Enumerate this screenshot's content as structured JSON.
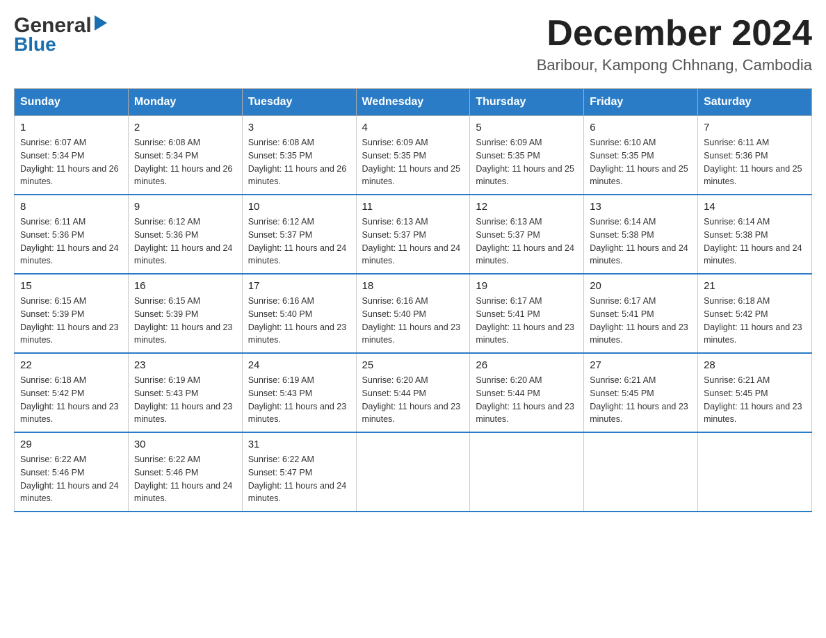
{
  "logo": {
    "general": "General",
    "blue": "Blue"
  },
  "header": {
    "month_year": "December 2024",
    "location": "Baribour, Kampong Chhnang, Cambodia"
  },
  "days_of_week": [
    "Sunday",
    "Monday",
    "Tuesday",
    "Wednesday",
    "Thursday",
    "Friday",
    "Saturday"
  ],
  "weeks": [
    [
      {
        "day": "1",
        "sunrise": "6:07 AM",
        "sunset": "5:34 PM",
        "daylight": "11 hours and 26 minutes."
      },
      {
        "day": "2",
        "sunrise": "6:08 AM",
        "sunset": "5:34 PM",
        "daylight": "11 hours and 26 minutes."
      },
      {
        "day": "3",
        "sunrise": "6:08 AM",
        "sunset": "5:35 PM",
        "daylight": "11 hours and 26 minutes."
      },
      {
        "day": "4",
        "sunrise": "6:09 AM",
        "sunset": "5:35 PM",
        "daylight": "11 hours and 25 minutes."
      },
      {
        "day": "5",
        "sunrise": "6:09 AM",
        "sunset": "5:35 PM",
        "daylight": "11 hours and 25 minutes."
      },
      {
        "day": "6",
        "sunrise": "6:10 AM",
        "sunset": "5:35 PM",
        "daylight": "11 hours and 25 minutes."
      },
      {
        "day": "7",
        "sunrise": "6:11 AM",
        "sunset": "5:36 PM",
        "daylight": "11 hours and 25 minutes."
      }
    ],
    [
      {
        "day": "8",
        "sunrise": "6:11 AM",
        "sunset": "5:36 PM",
        "daylight": "11 hours and 24 minutes."
      },
      {
        "day": "9",
        "sunrise": "6:12 AM",
        "sunset": "5:36 PM",
        "daylight": "11 hours and 24 minutes."
      },
      {
        "day": "10",
        "sunrise": "6:12 AM",
        "sunset": "5:37 PM",
        "daylight": "11 hours and 24 minutes."
      },
      {
        "day": "11",
        "sunrise": "6:13 AM",
        "sunset": "5:37 PM",
        "daylight": "11 hours and 24 minutes."
      },
      {
        "day": "12",
        "sunrise": "6:13 AM",
        "sunset": "5:37 PM",
        "daylight": "11 hours and 24 minutes."
      },
      {
        "day": "13",
        "sunrise": "6:14 AM",
        "sunset": "5:38 PM",
        "daylight": "11 hours and 24 minutes."
      },
      {
        "day": "14",
        "sunrise": "6:14 AM",
        "sunset": "5:38 PM",
        "daylight": "11 hours and 24 minutes."
      }
    ],
    [
      {
        "day": "15",
        "sunrise": "6:15 AM",
        "sunset": "5:39 PM",
        "daylight": "11 hours and 23 minutes."
      },
      {
        "day": "16",
        "sunrise": "6:15 AM",
        "sunset": "5:39 PM",
        "daylight": "11 hours and 23 minutes."
      },
      {
        "day": "17",
        "sunrise": "6:16 AM",
        "sunset": "5:40 PM",
        "daylight": "11 hours and 23 minutes."
      },
      {
        "day": "18",
        "sunrise": "6:16 AM",
        "sunset": "5:40 PM",
        "daylight": "11 hours and 23 minutes."
      },
      {
        "day": "19",
        "sunrise": "6:17 AM",
        "sunset": "5:41 PM",
        "daylight": "11 hours and 23 minutes."
      },
      {
        "day": "20",
        "sunrise": "6:17 AM",
        "sunset": "5:41 PM",
        "daylight": "11 hours and 23 minutes."
      },
      {
        "day": "21",
        "sunrise": "6:18 AM",
        "sunset": "5:42 PM",
        "daylight": "11 hours and 23 minutes."
      }
    ],
    [
      {
        "day": "22",
        "sunrise": "6:18 AM",
        "sunset": "5:42 PM",
        "daylight": "11 hours and 23 minutes."
      },
      {
        "day": "23",
        "sunrise": "6:19 AM",
        "sunset": "5:43 PM",
        "daylight": "11 hours and 23 minutes."
      },
      {
        "day": "24",
        "sunrise": "6:19 AM",
        "sunset": "5:43 PM",
        "daylight": "11 hours and 23 minutes."
      },
      {
        "day": "25",
        "sunrise": "6:20 AM",
        "sunset": "5:44 PM",
        "daylight": "11 hours and 23 minutes."
      },
      {
        "day": "26",
        "sunrise": "6:20 AM",
        "sunset": "5:44 PM",
        "daylight": "11 hours and 23 minutes."
      },
      {
        "day": "27",
        "sunrise": "6:21 AM",
        "sunset": "5:45 PM",
        "daylight": "11 hours and 23 minutes."
      },
      {
        "day": "28",
        "sunrise": "6:21 AM",
        "sunset": "5:45 PM",
        "daylight": "11 hours and 23 minutes."
      }
    ],
    [
      {
        "day": "29",
        "sunrise": "6:22 AM",
        "sunset": "5:46 PM",
        "daylight": "11 hours and 24 minutes."
      },
      {
        "day": "30",
        "sunrise": "6:22 AM",
        "sunset": "5:46 PM",
        "daylight": "11 hours and 24 minutes."
      },
      {
        "day": "31",
        "sunrise": "6:22 AM",
        "sunset": "5:47 PM",
        "daylight": "11 hours and 24 minutes."
      },
      null,
      null,
      null,
      null
    ]
  ]
}
